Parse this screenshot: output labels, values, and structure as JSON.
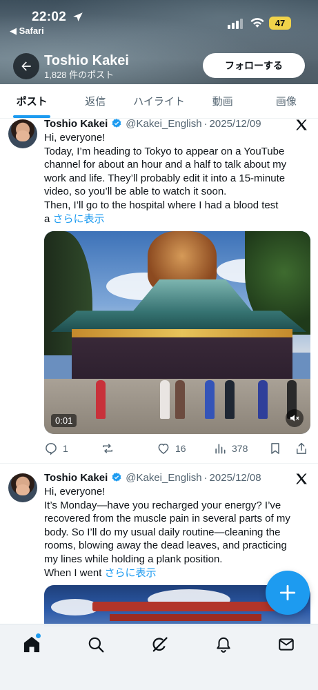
{
  "status_bar": {
    "time": "22:02",
    "back_app": "◀ Safari",
    "battery": "47"
  },
  "header": {
    "profile_name": "Toshio Kakei",
    "post_count": "1,828 件のポスト",
    "follow_label": "フォローする"
  },
  "tabs": [
    {
      "label": "ポスト",
      "active": true
    },
    {
      "label": "返信",
      "active": false
    },
    {
      "label": "ハイライト",
      "active": false
    },
    {
      "label": "動画",
      "active": false
    },
    {
      "label": "画像",
      "active": false
    }
  ],
  "posts": [
    {
      "author": "Toshio Kakei",
      "handle": "@Kakei_English",
      "separator": "·",
      "date": "2025/12/09",
      "lines": [
        "Hi, everyone!",
        "Today, I’m heading to Tokyo to appear on a YouTube",
        "channel for about an hour and a half to talk about my",
        "work and life. They’ll probably edit it into a 15-minute",
        "video, so you’ll be able to watch it soon.",
        "Then, I’ll go to the hospital where I had a blood test"
      ],
      "last_line_prefix": "a",
      "more_label": "さらに表示",
      "video_time": "0:01",
      "replies": "1",
      "reposts": "",
      "likes": "16",
      "views": "378"
    },
    {
      "author": "Toshio Kakei",
      "handle": "@Kakei_English",
      "separator": "·",
      "date": "2025/12/08",
      "lines": [
        "Hi, everyone!",
        "It’s Monday—have you recharged your energy? I’ve",
        "recovered from the muscle pain in several parts of my",
        "body. So I’ll do my usual daily routine—cleaning the",
        "rooms, blowing away the dead leaves, and practicing",
        "my lines while holding a plank position."
      ],
      "last_line_prefix": "When I went",
      "more_label": "さらに表示"
    }
  ],
  "colors": {
    "accent": "#1d9bf0",
    "text": "#0f1419",
    "muted": "#536471"
  },
  "icons": {
    "back": "arrow-left-icon",
    "verified": "verified-badge-icon",
    "x": "x-logo-icon",
    "reply": "reply-icon",
    "repost": "repost-icon",
    "like": "heart-icon",
    "views": "views-chart-icon",
    "bookmark": "bookmark-icon",
    "share": "share-icon",
    "mute": "speaker-muted-icon",
    "compose": "plus-icon",
    "nav": [
      "home-icon",
      "search-icon",
      "grok-icon",
      "bell-icon",
      "mail-icon"
    ]
  }
}
